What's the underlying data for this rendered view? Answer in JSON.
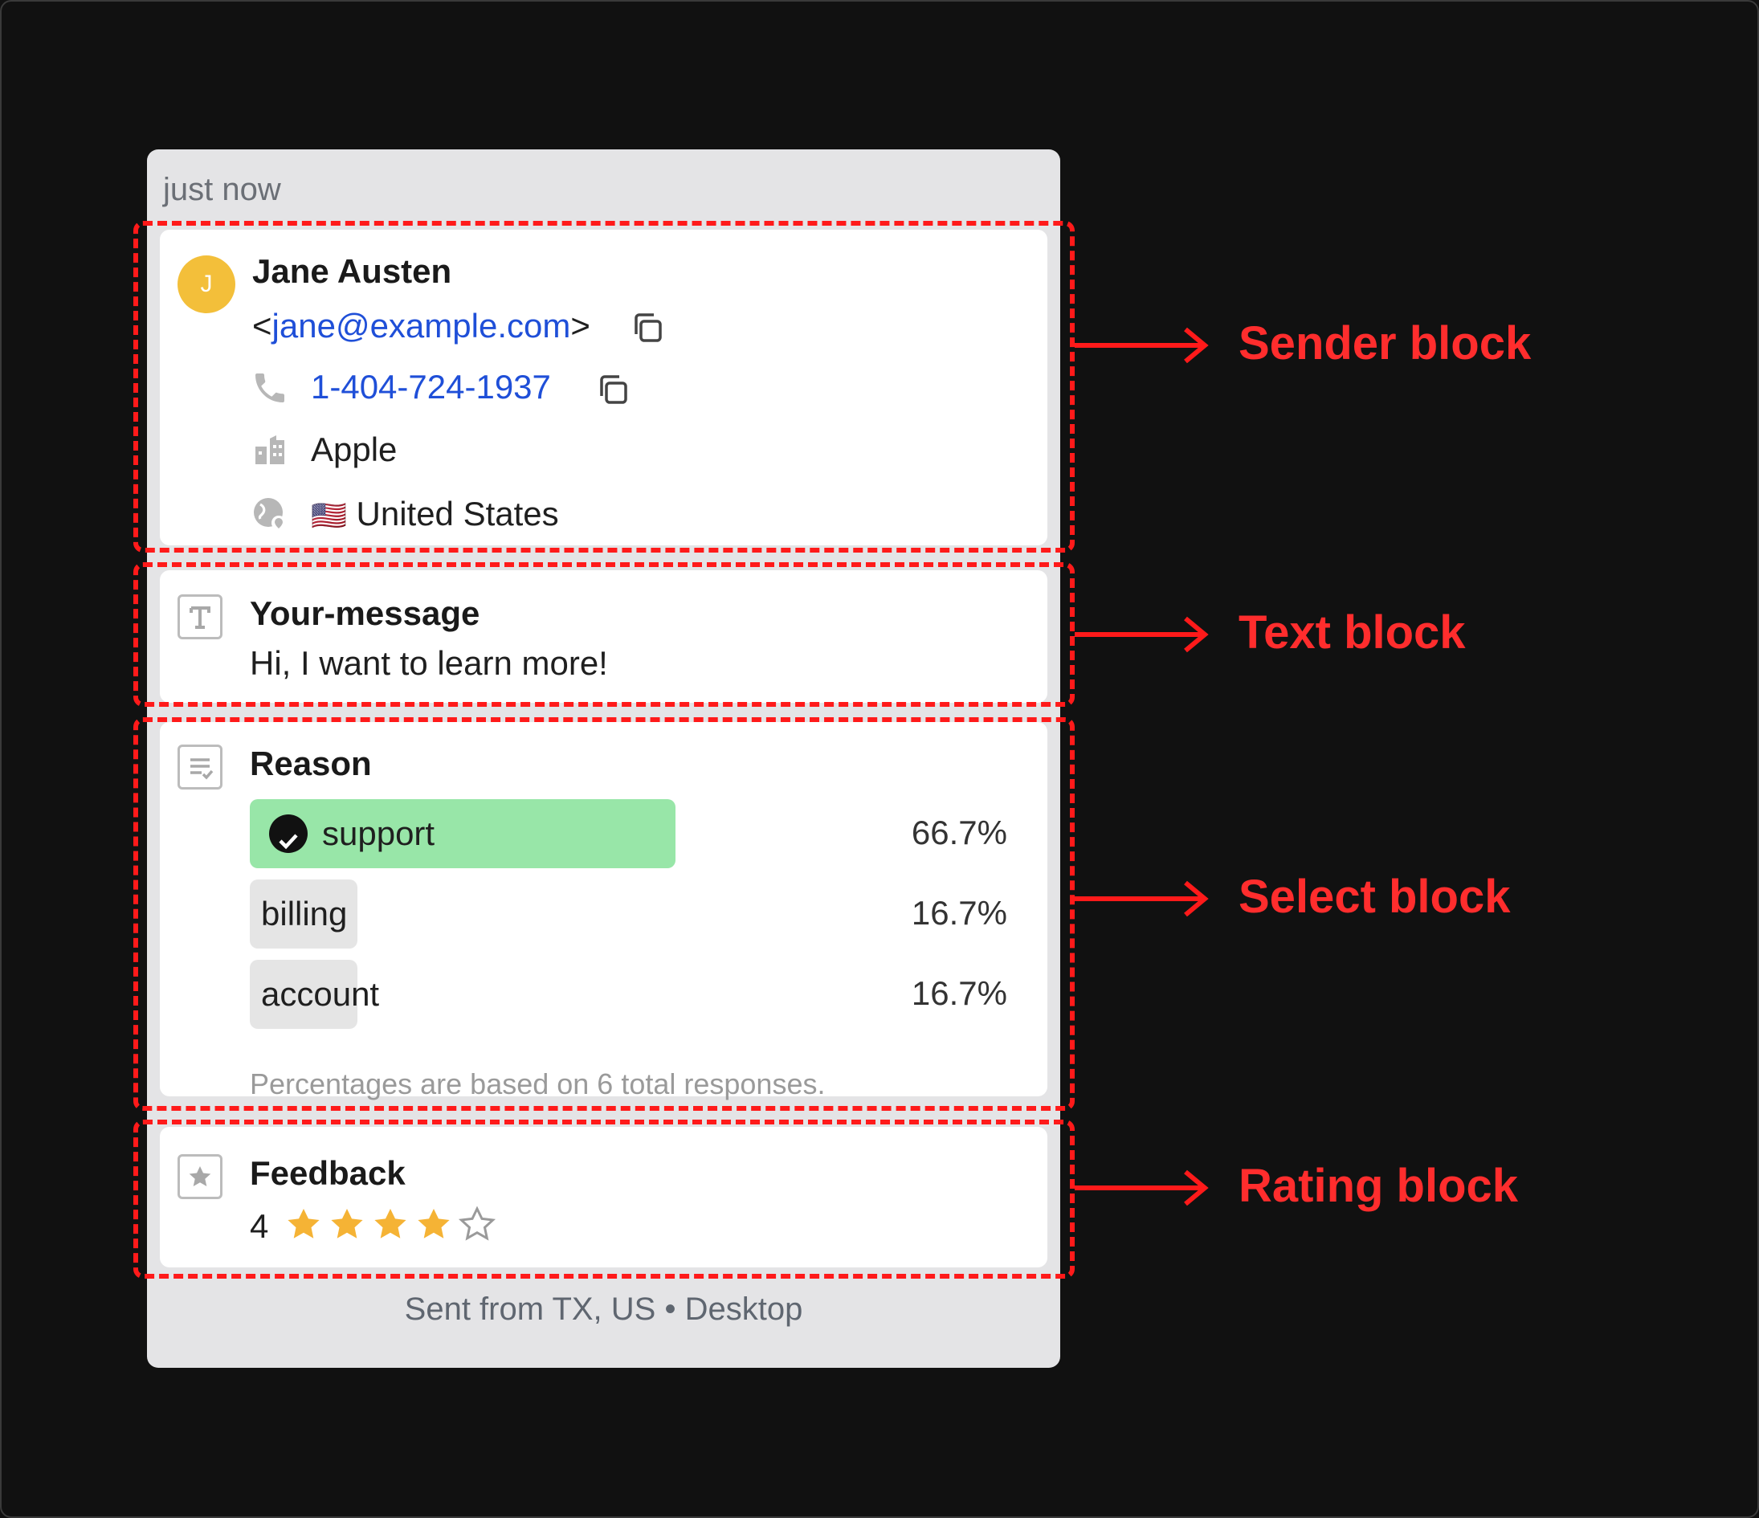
{
  "card": {
    "timestamp": "just now",
    "footer": "Sent from TX, US • Desktop"
  },
  "sender": {
    "avatar_initial": "J",
    "name": "Jane Austen",
    "email_prefix": "<",
    "email": "jane@example.com",
    "email_suffix": ">",
    "phone": "1-404-724-1937",
    "company": "Apple",
    "country_flag": "🇺🇸",
    "country": "United States"
  },
  "text_block": {
    "title": "Your-message",
    "body": "Hi, I want to learn more!"
  },
  "select_block": {
    "title": "Reason",
    "options": [
      {
        "label": "support",
        "percent_text": "66.7%",
        "selected": true
      },
      {
        "label": "billing",
        "percent_text": "16.7%",
        "selected": false
      },
      {
        "label": "account",
        "percent_text": "16.7%",
        "selected": false
      }
    ],
    "note": "Percentages are based on 6 total responses."
  },
  "rating_block": {
    "title": "Feedback",
    "value_text": "4",
    "rating": 4,
    "max": 5,
    "star_color": "#f5b335"
  },
  "callouts": {
    "sender": "Sender block",
    "text": "Text block",
    "select": "Select block",
    "rating": "Rating block",
    "color": "#ff2d2d"
  }
}
